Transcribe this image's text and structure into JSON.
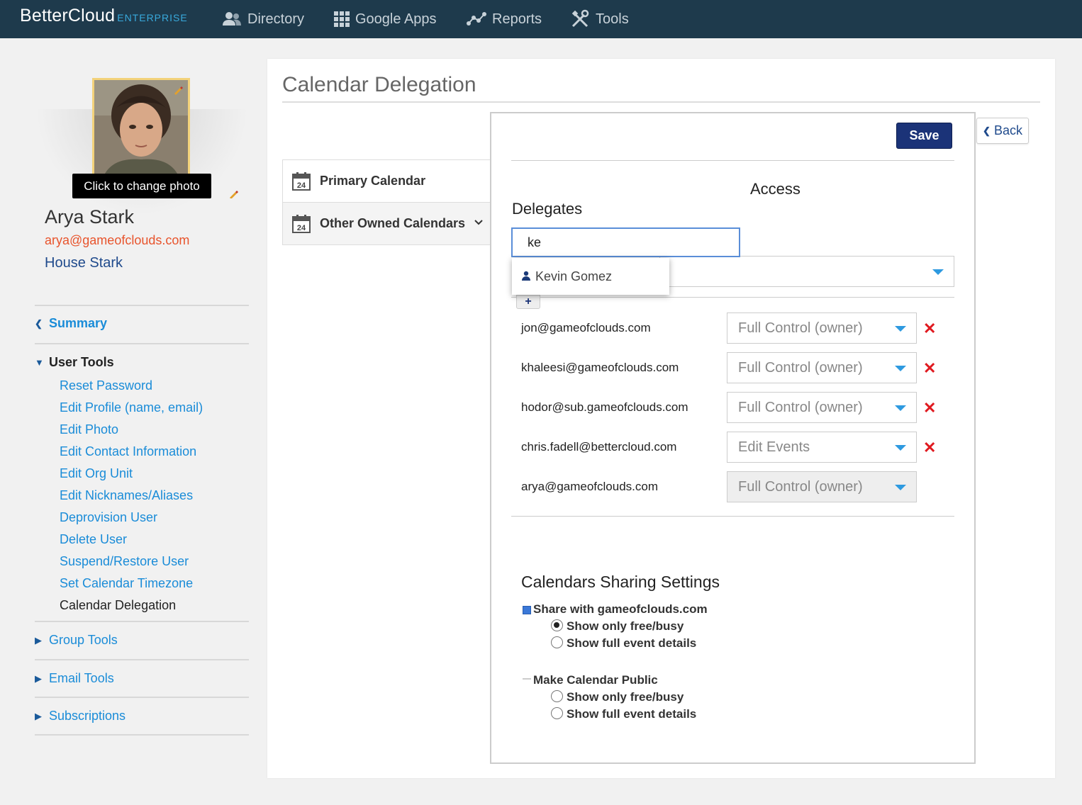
{
  "brand": {
    "name": "BetterCloud",
    "edition": "ENTERPRISE"
  },
  "nav": [
    {
      "label": "Directory",
      "icon": "users-icon"
    },
    {
      "label": "Google Apps",
      "icon": "grid-icon"
    },
    {
      "label": "Reports",
      "icon": "line-chart-icon"
    },
    {
      "label": "Tools",
      "icon": "tools-icon"
    }
  ],
  "profile": {
    "photo_tooltip": "Click to change photo",
    "name": "Arya Stark",
    "email": "arya@gameofclouds.com",
    "org_unit": "House Stark"
  },
  "sidebar": {
    "summary": "Summary",
    "user_tools": "User Tools",
    "tools": [
      "Reset Password",
      "Edit Profile (name, email)",
      "Edit Photo",
      "Edit Contact Information",
      "Edit Org Unit",
      "Edit Nicknames/Aliases",
      "Deprovision User",
      "Delete User",
      "Suspend/Restore User",
      "Set Calendar Timezone",
      "Calendar Delegation"
    ],
    "active_tool": "Calendar Delegation",
    "group_tools": "Group Tools",
    "email_tools": "Email Tools",
    "subscriptions": "Subscriptions"
  },
  "main": {
    "title": "Calendar Delegation",
    "calendar_tabs": [
      {
        "label": "Primary Calendar",
        "icon_day": "24"
      },
      {
        "label": "Other Owned Calendars",
        "icon_day": "24"
      }
    ],
    "save_label": "Save",
    "back_label": "Back",
    "delegates_header": "Delegates",
    "access_header": "Access",
    "search_value": "ke",
    "autocomplete": [
      "Kevin Gomez"
    ],
    "add_label": "+",
    "delegates": [
      {
        "email": "jon@gameofclouds.com",
        "access": "Full Control (owner)",
        "removable": true
      },
      {
        "email": "khaleesi@gameofclouds.com",
        "access": "Full Control (owner)",
        "removable": true
      },
      {
        "email": "hodor@sub.gameofclouds.com",
        "access": "Full Control (owner)",
        "removable": true
      },
      {
        "email": "chris.fadell@bettercloud.com",
        "access": "Edit Events",
        "removable": true
      },
      {
        "email": "arya@gameofclouds.com",
        "access": "Full Control (owner)",
        "removable": false
      }
    ],
    "remove_glyph": "✕",
    "sharing": {
      "title": "Calendars Sharing Settings",
      "domain": {
        "label": "Share with gameofclouds.com",
        "checked": true,
        "options": [
          "Show only free/busy",
          "Show full event details"
        ],
        "selected": 0
      },
      "public": {
        "label": "Make Calendar Public",
        "checked": false,
        "options": [
          "Show only free/busy",
          "Show full event details"
        ],
        "selected": null
      }
    }
  },
  "colors": {
    "nav_bg": "#1e3a4c",
    "accent_blue": "#1a8cd8",
    "save_blue": "#1b3378",
    "email_orange": "#e8542c",
    "remove_red": "#e0191f"
  }
}
